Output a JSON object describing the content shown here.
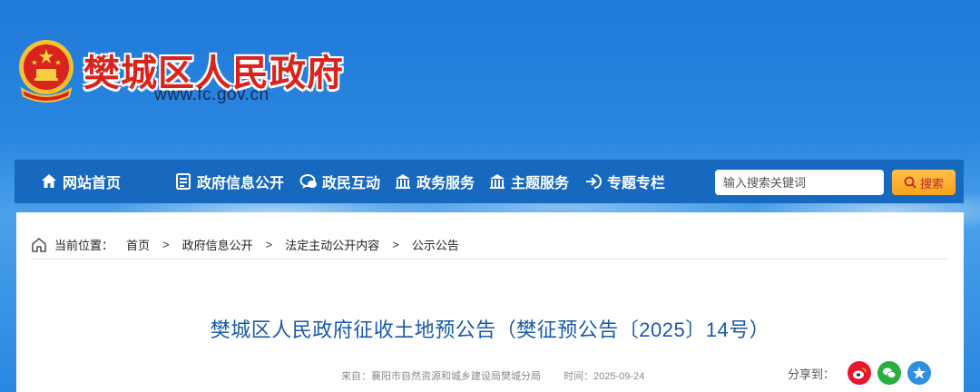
{
  "header": {
    "site_title": "樊城区人民政府",
    "site_url": "www.fc.gov.cn"
  },
  "nav": {
    "items": [
      {
        "label": "网站首页",
        "icon": "home-icon"
      },
      {
        "label": "政府信息公开",
        "icon": "document-icon"
      },
      {
        "label": "政民互动",
        "icon": "chat-icon"
      },
      {
        "label": "政务服务",
        "icon": "building-icon"
      },
      {
        "label": "主题服务",
        "icon": "building-icon"
      },
      {
        "label": "专题专栏",
        "icon": "enter-icon"
      }
    ],
    "search_placeholder": "输入搜索关键词",
    "search_button": "搜索"
  },
  "breadcrumb": {
    "label": "当前位置：",
    "items": [
      "首页",
      "政府信息公开",
      "法定主动公开内容",
      "公示公告"
    ],
    "separator": ">"
  },
  "article": {
    "title": "樊城区人民政府征收土地预公告（樊征预公告〔2025〕14号）",
    "source": "来自：襄阳市自然资源和城乡建设局樊城分局",
    "time": "时间：2025-09-24"
  },
  "share": {
    "label": "分享到：",
    "targets": [
      "weibo-icon",
      "wechat-icon",
      "qzone-icon"
    ]
  },
  "colors": {
    "nav_bg": "#1669bf",
    "title_red": "#d8241c",
    "article_title": "#1a5aa6",
    "search_btn": "#f7a21a"
  }
}
